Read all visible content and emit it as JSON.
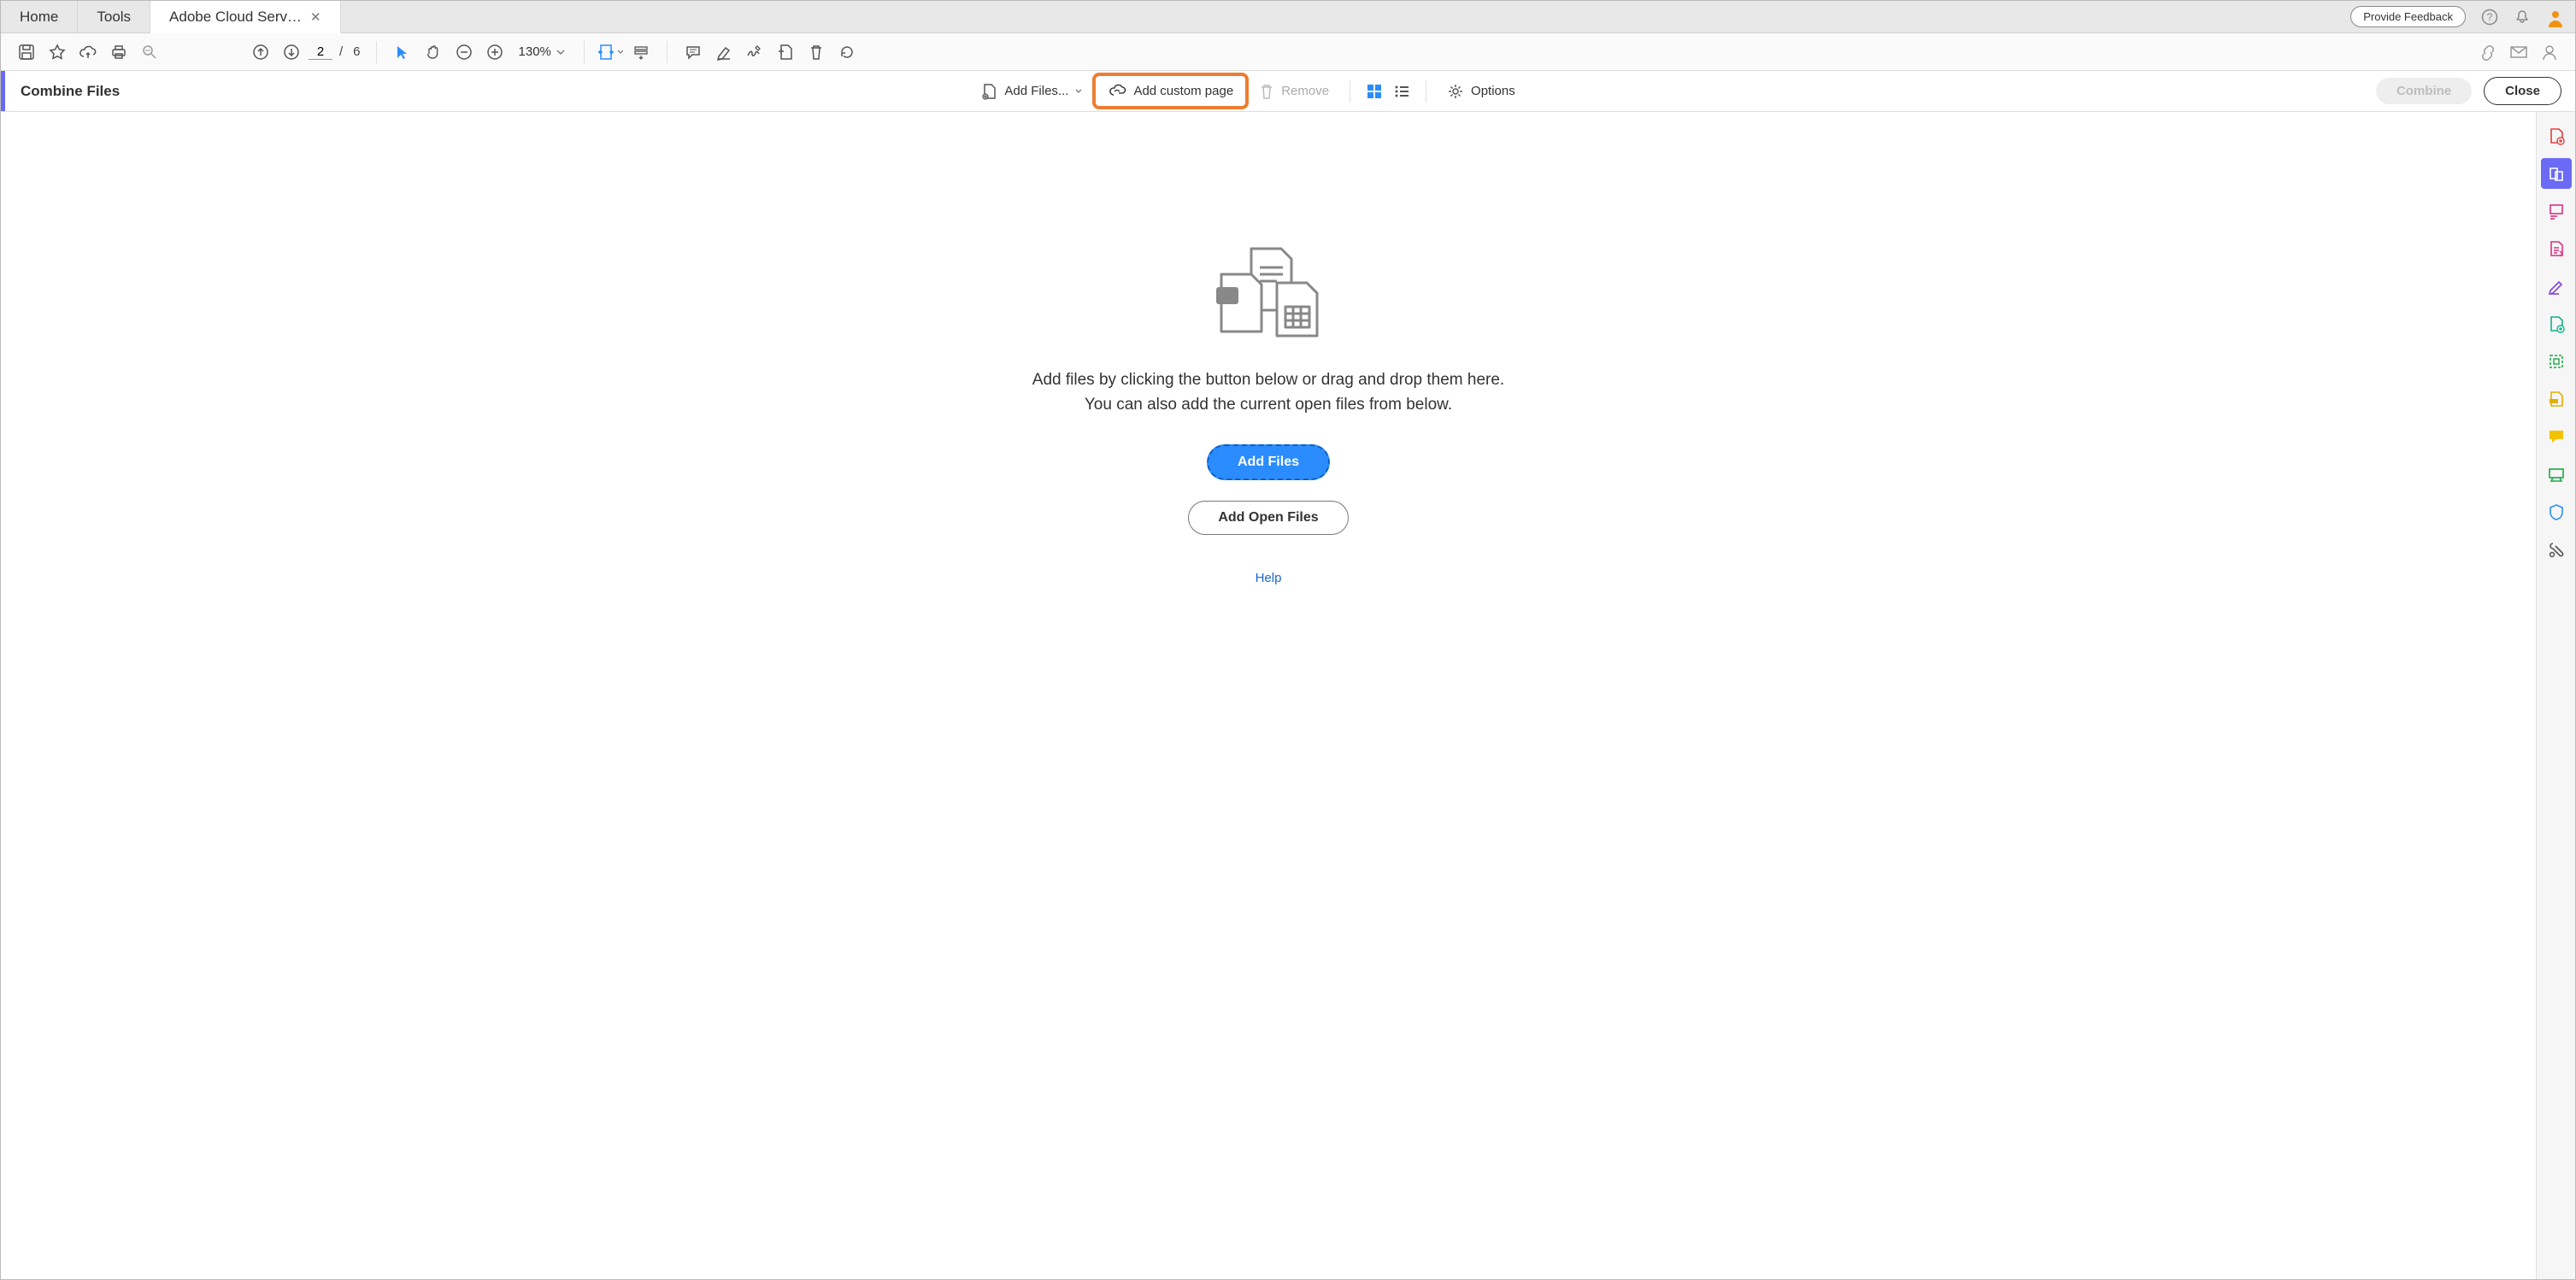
{
  "tabs": {
    "home": "Home",
    "tools": "Tools",
    "doc": "Adobe Cloud Serv…"
  },
  "topbar": {
    "feedback": "Provide Feedback"
  },
  "toolbar": {
    "page_current": "2",
    "page_sep": "/",
    "page_total": "6",
    "zoom": "130%"
  },
  "subbar": {
    "title": "Combine Files",
    "add_files": "Add Files...",
    "add_custom": "Add custom page",
    "remove": "Remove",
    "options": "Options",
    "combine": "Combine",
    "close": "Close"
  },
  "canvas": {
    "hint1": "Add files by clicking the button below or drag and drop them here.",
    "hint2": "You can also add the current open files from below.",
    "add_files_btn": "Add Files",
    "add_open_btn": "Add Open Files",
    "help": "Help"
  },
  "colors": {
    "accent": "#6a6af4",
    "highlight": "#ed7d31",
    "primary_blue": "#2a8cff"
  }
}
